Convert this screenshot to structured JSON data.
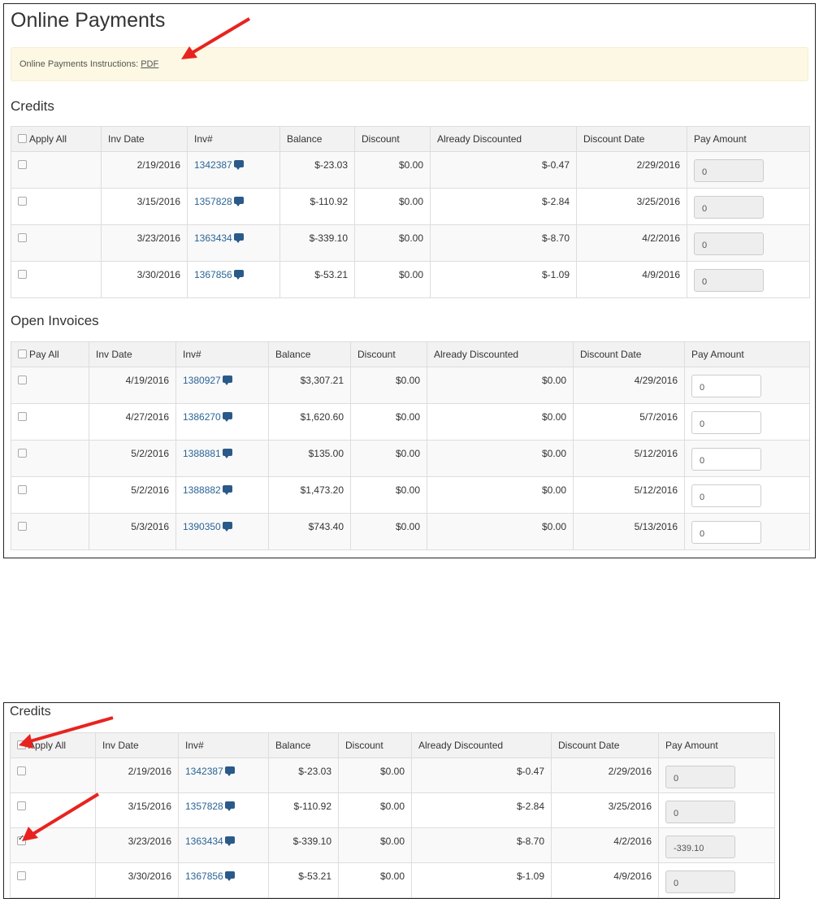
{
  "page": {
    "title": "Online Payments",
    "instructions_label": "Online Payments Instructions:",
    "instructions_link": "PDF"
  },
  "credits": {
    "title": "Credits",
    "headers": [
      "Apply All",
      "Inv Date",
      "Inv#",
      "Balance",
      "Discount",
      "Already Discounted",
      "Discount Date",
      "Pay Amount"
    ],
    "rows": [
      {
        "checked": false,
        "inv_date": "2/19/2016",
        "inv": "1342387",
        "balance": "$-23.03",
        "discount": "$0.00",
        "already_discounted": "$-0.47",
        "discount_date": "2/29/2016",
        "pay_amount": "0"
      },
      {
        "checked": false,
        "inv_date": "3/15/2016",
        "inv": "1357828",
        "balance": "$-110.92",
        "discount": "$0.00",
        "already_discounted": "$-2.84",
        "discount_date": "3/25/2016",
        "pay_amount": "0"
      },
      {
        "checked": false,
        "inv_date": "3/23/2016",
        "inv": "1363434",
        "balance": "$-339.10",
        "discount": "$0.00",
        "already_discounted": "$-8.70",
        "discount_date": "4/2/2016",
        "pay_amount": "0"
      },
      {
        "checked": false,
        "inv_date": "3/30/2016",
        "inv": "1367856",
        "balance": "$-53.21",
        "discount": "$0.00",
        "already_discounted": "$-1.09",
        "discount_date": "4/9/2016",
        "pay_amount": "0"
      }
    ]
  },
  "open_invoices": {
    "title": "Open Invoices",
    "headers": [
      "Pay All",
      "Inv Date",
      "Inv#",
      "Balance",
      "Discount",
      "Already Discounted",
      "Discount Date",
      "Pay Amount"
    ],
    "rows": [
      {
        "checked": false,
        "inv_date": "4/19/2016",
        "inv": "1380927",
        "balance": "$3,307.21",
        "discount": "$0.00",
        "already_discounted": "$0.00",
        "discount_date": "4/29/2016",
        "pay_amount": "0"
      },
      {
        "checked": false,
        "inv_date": "4/27/2016",
        "inv": "1386270",
        "balance": "$1,620.60",
        "discount": "$0.00",
        "already_discounted": "$0.00",
        "discount_date": "5/7/2016",
        "pay_amount": "0"
      },
      {
        "checked": false,
        "inv_date": "5/2/2016",
        "inv": "1388881",
        "balance": "$135.00",
        "discount": "$0.00",
        "already_discounted": "$0.00",
        "discount_date": "5/12/2016",
        "pay_amount": "0"
      },
      {
        "checked": false,
        "inv_date": "5/2/2016",
        "inv": "1388882",
        "balance": "$1,473.20",
        "discount": "$0.00",
        "already_discounted": "$0.00",
        "discount_date": "5/12/2016",
        "pay_amount": "0"
      },
      {
        "checked": false,
        "inv_date": "5/3/2016",
        "inv": "1390350",
        "balance": "$743.40",
        "discount": "$0.00",
        "already_discounted": "$0.00",
        "discount_date": "5/13/2016",
        "pay_amount": "0"
      }
    ]
  },
  "credits_selected": {
    "title": "Credits",
    "headers": [
      "Apply All",
      "Inv Date",
      "Inv#",
      "Balance",
      "Discount",
      "Already Discounted",
      "Discount Date",
      "Pay Amount"
    ],
    "rows": [
      {
        "checked": false,
        "inv_date": "2/19/2016",
        "inv": "1342387",
        "balance": "$-23.03",
        "discount": "$0.00",
        "already_discounted": "$-0.47",
        "discount_date": "2/29/2016",
        "pay_amount": "0"
      },
      {
        "checked": false,
        "inv_date": "3/15/2016",
        "inv": "1357828",
        "balance": "$-110.92",
        "discount": "$0.00",
        "already_discounted": "$-2.84",
        "discount_date": "3/25/2016",
        "pay_amount": "0"
      },
      {
        "checked": true,
        "inv_date": "3/23/2016",
        "inv": "1363434",
        "balance": "$-339.10",
        "discount": "$0.00",
        "already_discounted": "$-8.70",
        "discount_date": "4/2/2016",
        "pay_amount": "-339.10"
      },
      {
        "checked": false,
        "inv_date": "3/30/2016",
        "inv": "1367856",
        "balance": "$-53.21",
        "discount": "$0.00",
        "already_discounted": "$-1.09",
        "discount_date": "4/9/2016",
        "pay_amount": "0"
      }
    ]
  },
  "colors": {
    "annotation_arrow": "#e8231f",
    "link": "#2a6496",
    "notice_bg": "#fcf8e3"
  }
}
